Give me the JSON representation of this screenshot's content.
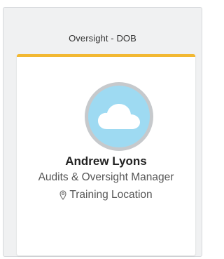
{
  "panel": {
    "title": "Oversight - DOB"
  },
  "card": {
    "accent_color": "#f2b832",
    "avatar_icon": "cloud-icon",
    "name": "Andrew Lyons",
    "role": "Audits & Oversight Manager",
    "location_icon": "location-pin-icon",
    "location": "Training Location"
  }
}
